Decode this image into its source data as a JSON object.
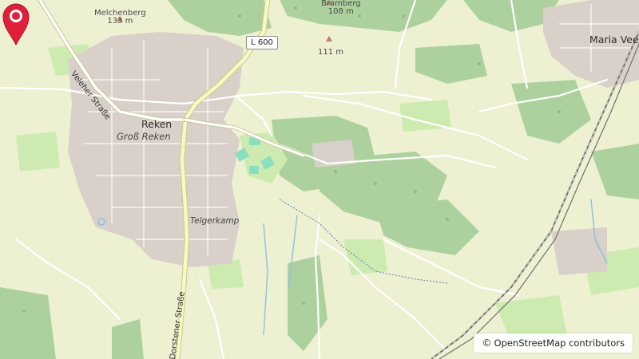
{
  "map": {
    "labels": {
      "melchenberg": "Melchenberg",
      "melchenberg_elev": "133 m",
      "bramberg": "Bramberg",
      "bramberg_elev": "108 m",
      "unnamed_peak_elev": "111 m",
      "maria_veen": "Maria Veen",
      "reken": "Reken",
      "gross_reken": "Groß Reken",
      "telgerkamp": "Telgerkamp",
      "veleher_strasse": "Veleher Straße",
      "dorstener_strasse": "Dorstener Straße",
      "road_ref": "L 600"
    },
    "attribution": {
      "symbol": "©",
      "text": "OpenStreetMap contributors"
    },
    "colors": {
      "background": "#eef0d2",
      "forest": "#add19e",
      "meadow": "#cdebb0",
      "residential": "#d9d0c9",
      "major_road": "#f7fabf",
      "major_road_casing": "#c8c896",
      "minor_road": "#ffffff",
      "railway": "#707070",
      "water": "#8fbfe0",
      "marker": "#e0203a"
    }
  }
}
